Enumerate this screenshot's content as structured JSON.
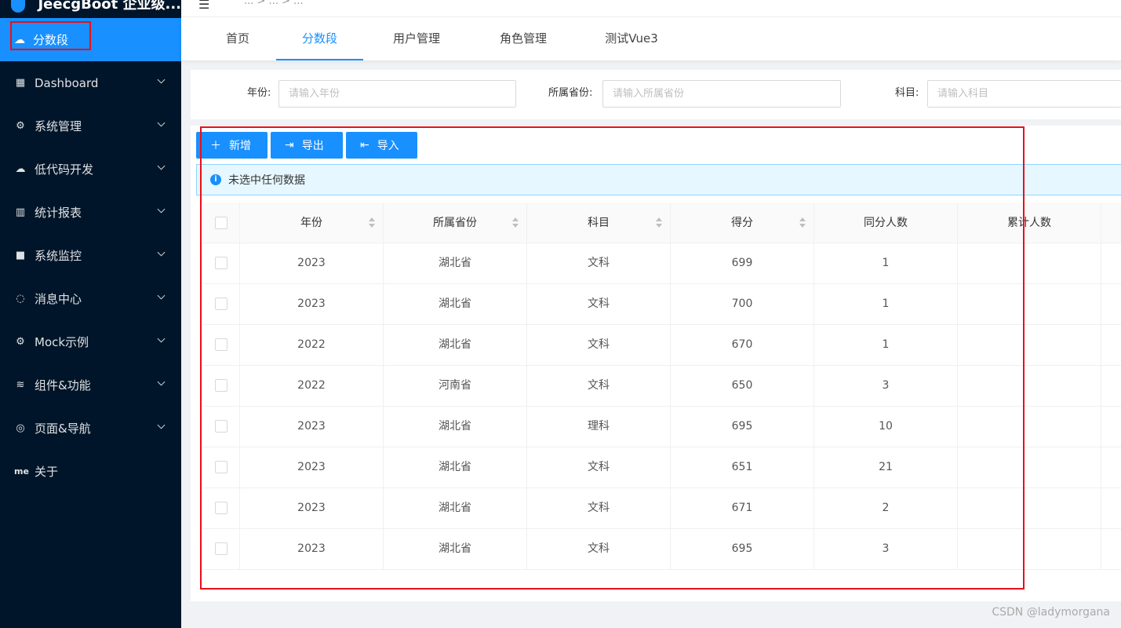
{
  "app": {
    "logo_text": "JeecgBoot 企业级..."
  },
  "header": {
    "menu_icon": "menu-fold-icon",
    "breadcrumb": "...  >  ...  >  ..."
  },
  "sidebar": {
    "active": {
      "label": "分数段",
      "icon": "cloud-icon"
    },
    "items": [
      {
        "label": "Dashboard",
        "icon": "appstore-icon"
      },
      {
        "label": "系统管理",
        "icon": "setting-icon"
      },
      {
        "label": "低代码开发",
        "icon": "cloud-icon"
      },
      {
        "label": "统计报表",
        "icon": "bar-chart-icon"
      },
      {
        "label": "系统监控",
        "icon": "video-camera-icon"
      },
      {
        "label": "消息中心",
        "icon": "message-icon"
      },
      {
        "label": "Mock示例",
        "icon": "setting-icon"
      },
      {
        "label": "组件&功能",
        "icon": "layers-icon"
      },
      {
        "label": "页面&导航",
        "icon": "aperture-icon"
      },
      {
        "label": "关于",
        "icon": "me-icon",
        "icon_text": "me"
      }
    ]
  },
  "tabs": [
    "首页",
    "分数段",
    "用户管理",
    "角色管理",
    "测试Vue3"
  ],
  "active_tab": "分数段",
  "search": {
    "year_label": "年份:",
    "year_placeholder": "请输入年份",
    "province_label": "所属省份:",
    "province_placeholder": "请输入所属省份",
    "subject_label": "科目:",
    "subject_placeholder": "请输入科目"
  },
  "toolbar": {
    "add_label": "新增",
    "export_label": "导出",
    "import_label": "导入"
  },
  "alert": {
    "text": "未选中任何数据",
    "icon": "info-circle-icon"
  },
  "table": {
    "columns": [
      "年份",
      "所属省份",
      "科目",
      "得分",
      "同分人数",
      "累计人数"
    ],
    "rows": [
      [
        "2023",
        "湖北省",
        "文科",
        "699",
        "1",
        ""
      ],
      [
        "2023",
        "湖北省",
        "文科",
        "700",
        "1",
        ""
      ],
      [
        "2022",
        "湖北省",
        "文科",
        "670",
        "1",
        ""
      ],
      [
        "2022",
        "河南省",
        "文科",
        "650",
        "3",
        ""
      ],
      [
        "2023",
        "湖北省",
        "理科",
        "695",
        "10",
        ""
      ],
      [
        "2023",
        "湖北省",
        "文科",
        "651",
        "21",
        ""
      ],
      [
        "2023",
        "湖北省",
        "文科",
        "671",
        "2",
        ""
      ],
      [
        "2023",
        "湖北省",
        "文科",
        "695",
        "3",
        ""
      ]
    ]
  },
  "watermark": "CSDN @ladymorgana",
  "colors": {
    "sidebar_bg": "#001529",
    "primary": "#1890ff",
    "highlight_box": "#e8101a"
  }
}
